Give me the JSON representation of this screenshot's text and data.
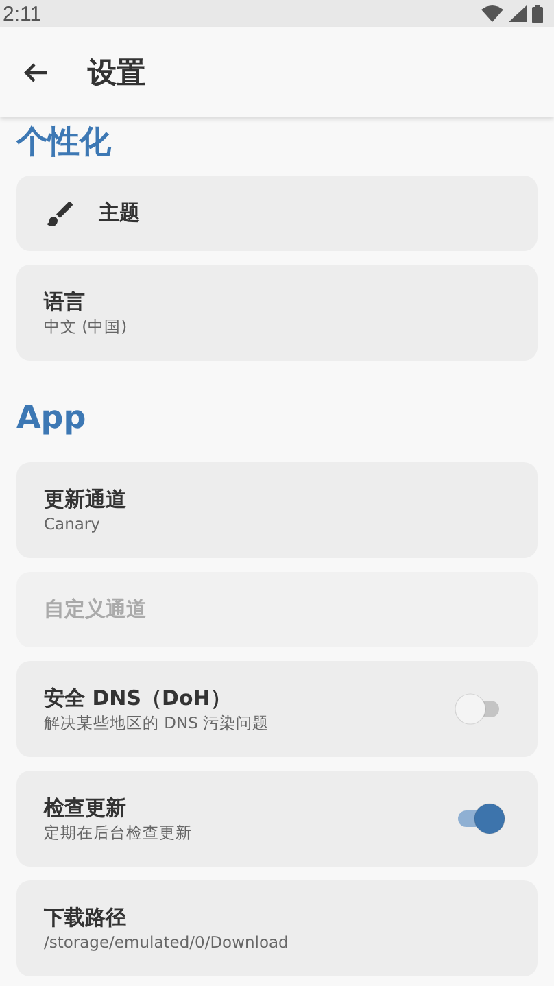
{
  "status_bar": {
    "time": "2:11"
  },
  "app_bar": {
    "title": "设置"
  },
  "sections": [
    {
      "heading": "个性化",
      "items": [
        {
          "kind": "icon",
          "title": "主题"
        },
        {
          "kind": "text",
          "title": "语言",
          "subtitle": "中文 (中国)"
        }
      ]
    },
    {
      "heading": "App",
      "items": [
        {
          "kind": "text",
          "title": "更新通道",
          "subtitle": "Canary"
        },
        {
          "kind": "text",
          "title": "自定义通道",
          "disabled": true
        },
        {
          "kind": "switch",
          "title": "安全 DNS（DoH）",
          "subtitle": "解决某些地区的 DNS 污染问题",
          "on": false
        },
        {
          "kind": "switch",
          "title": "检查更新",
          "subtitle": "定期在后台检查更新",
          "on": true
        },
        {
          "kind": "text",
          "title": "下载路径",
          "subtitle": "/storage/emulated/0/Download"
        }
      ]
    }
  ]
}
